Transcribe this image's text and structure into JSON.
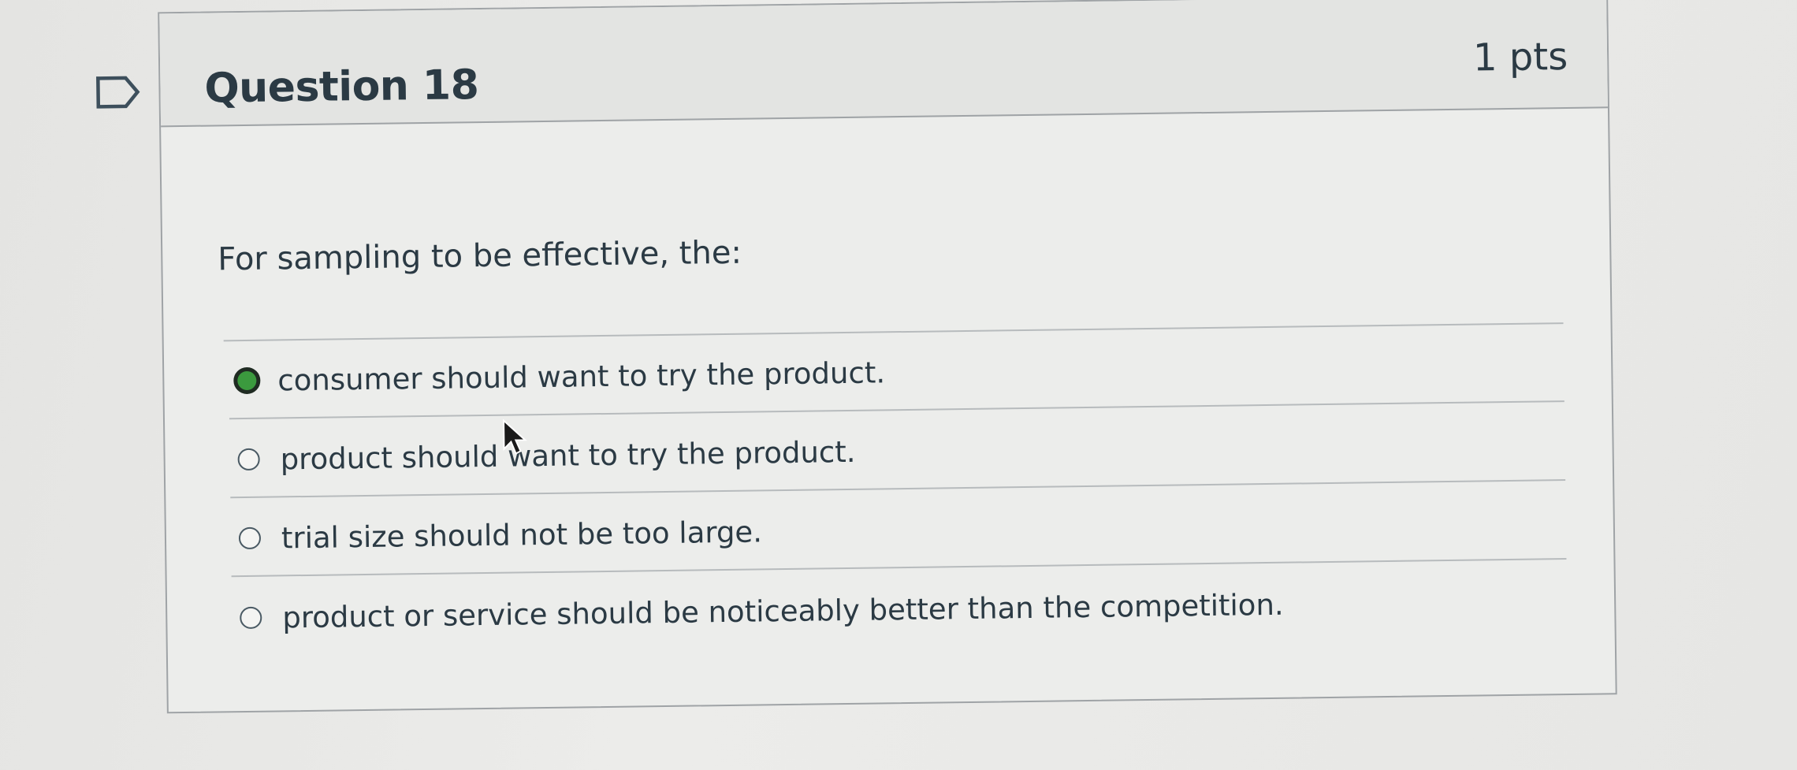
{
  "question": {
    "title": "Question 18",
    "points": "1 pts",
    "text": "For sampling to be effective, the:",
    "flag_icon": "flag-outline-icon"
  },
  "answers": [
    {
      "label": "consumer should want to try the product.",
      "selected": true
    },
    {
      "label": "product should want to try the product.",
      "selected": false
    },
    {
      "label": "trial size should not be too large.",
      "selected": false
    },
    {
      "label": "product or service should be noticeably better than the competition.",
      "selected": false
    }
  ],
  "colors": {
    "selected_radio": "#3b9a3e",
    "text": "#2b3a44",
    "border": "#9fa3a6"
  }
}
